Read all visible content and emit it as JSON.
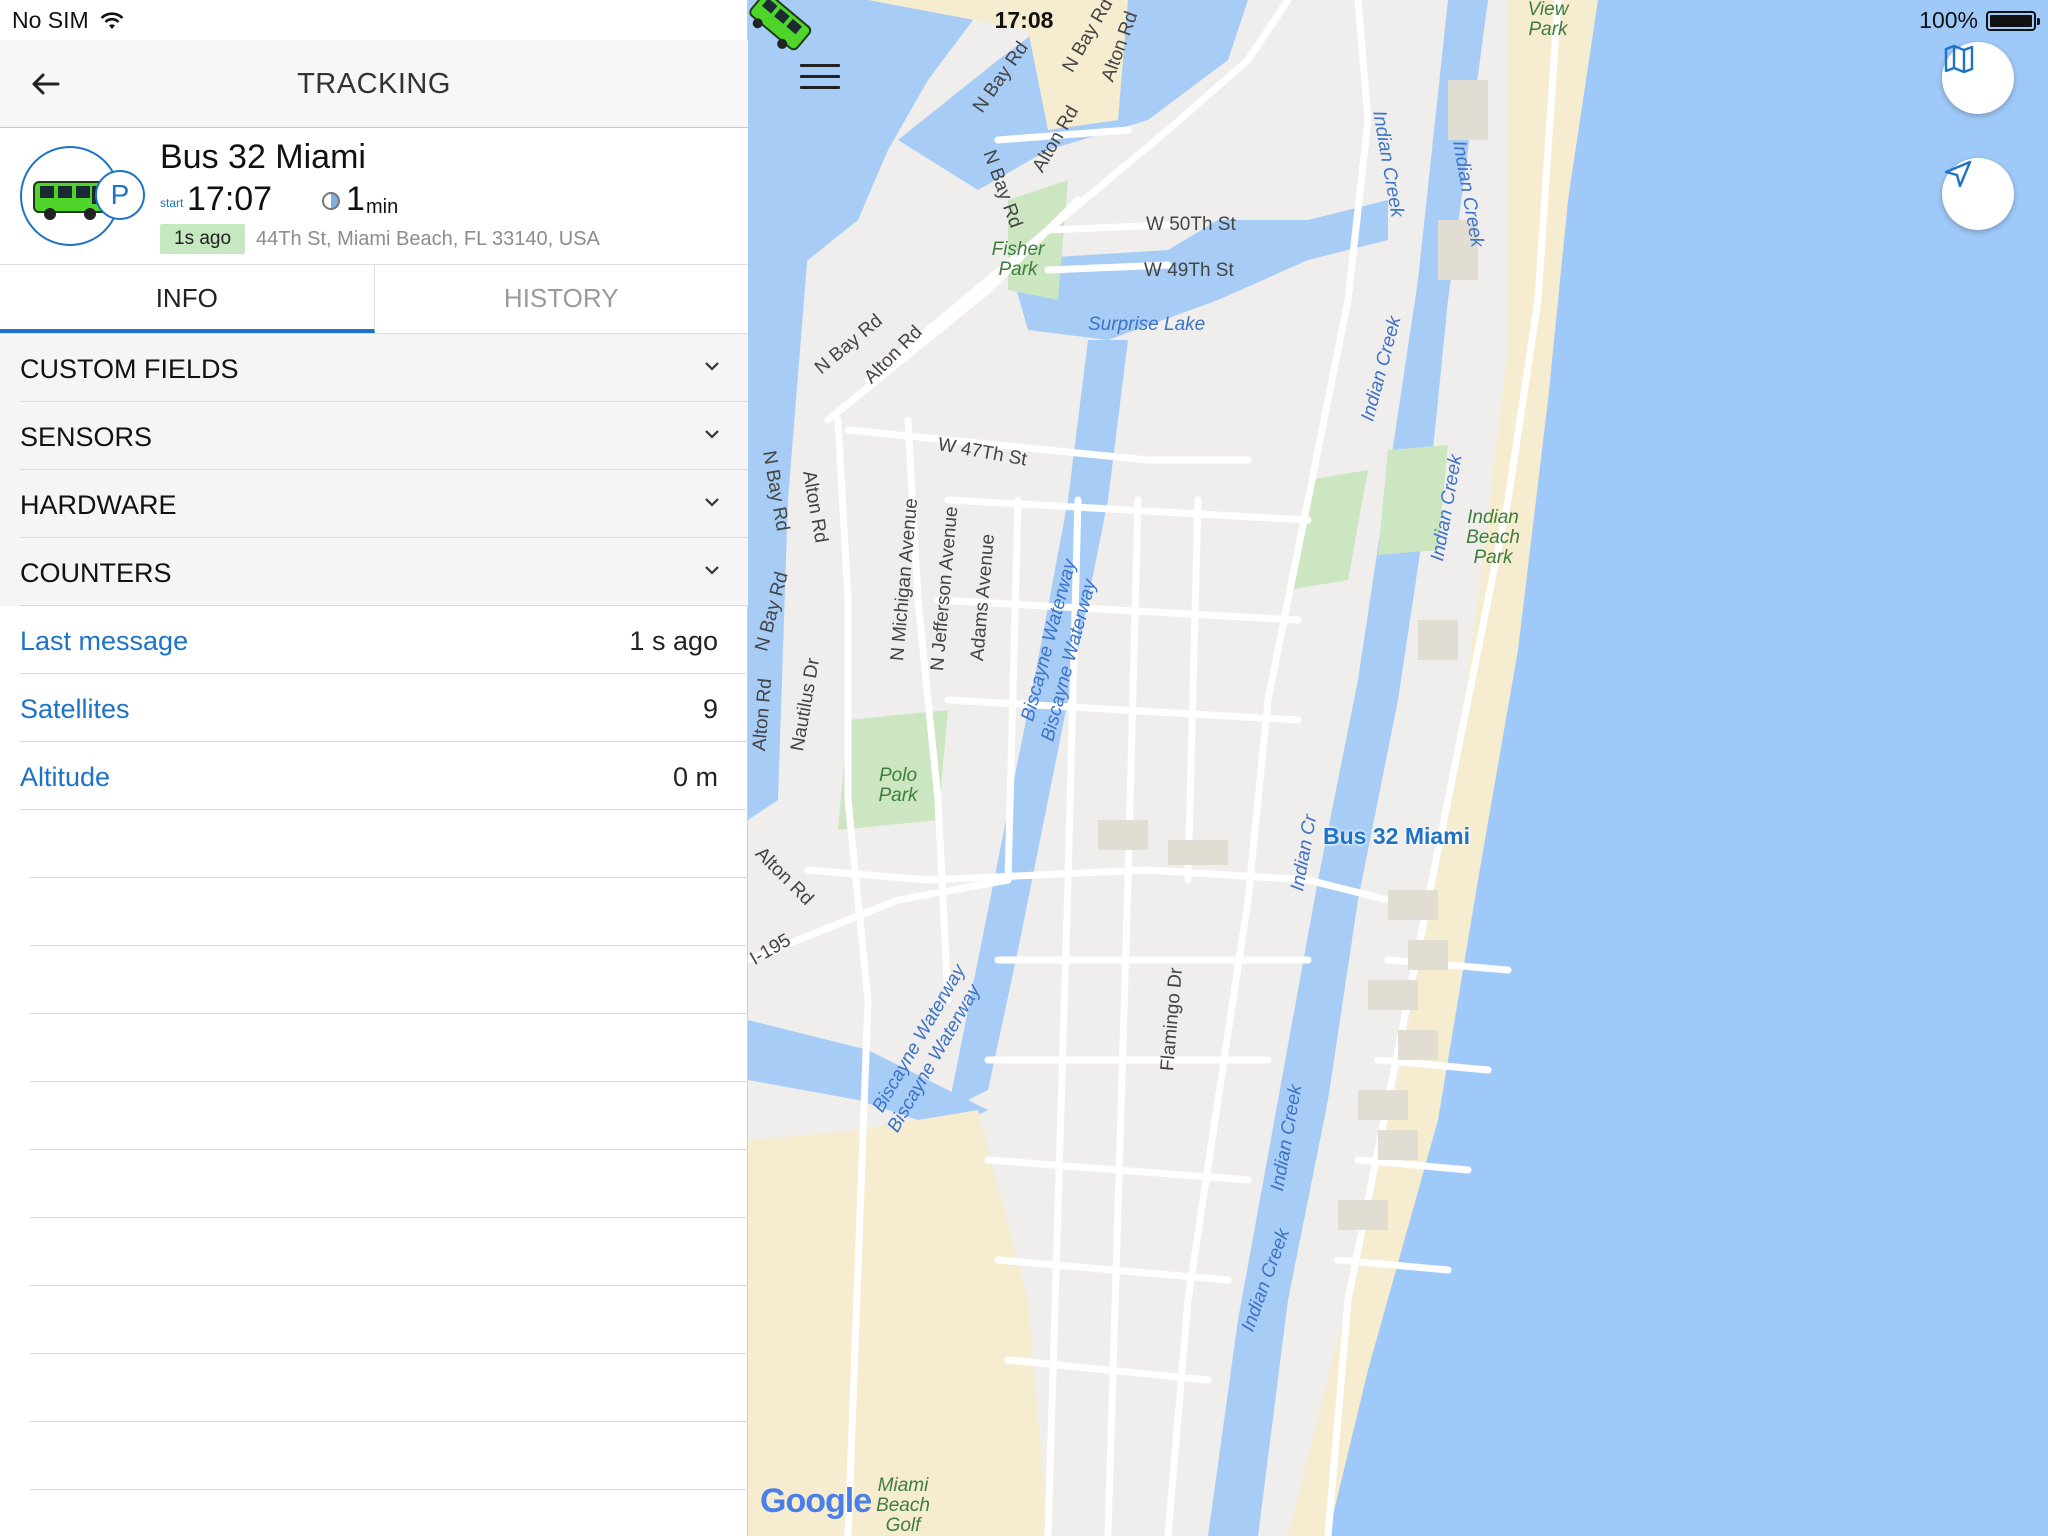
{
  "status_bar": {
    "carrier": "No SIM",
    "time": "17:08",
    "battery": "100%"
  },
  "header": {
    "title": "TRACKING"
  },
  "unit": {
    "name": "Bus 32 Miami",
    "start_label": "start",
    "start_time": "17:07",
    "duration_value": "1",
    "duration_unit": "min",
    "last_update": "1s ago",
    "address": "44Th St, Miami Beach, FL 33140, USA",
    "parking_badge": "P"
  },
  "tabs": [
    {
      "label": "INFO",
      "active": true
    },
    {
      "label": "HISTORY",
      "active": false
    }
  ],
  "sections": [
    {
      "label": "CUSTOM FIELDS"
    },
    {
      "label": "SENSORS"
    },
    {
      "label": "HARDWARE"
    },
    {
      "label": "COUNTERS"
    }
  ],
  "rows": [
    {
      "label": "Last message",
      "value": "1 s ago"
    },
    {
      "label": "Satellites",
      "value": "9"
    },
    {
      "label": "Altitude",
      "value": "0 m"
    }
  ],
  "map": {
    "marker_label": "Bus 32 Miami",
    "attribution": "Google",
    "streets": [
      "N Bay Rd",
      "N Bay Rd",
      "Alton Rd",
      "Alton Rd",
      "N Bay Rd",
      "W 50Th St",
      "W 49Th St",
      "N Bay Rd",
      "Alton Rd",
      "W 47Th St",
      "N Bay Rd",
      "Alton Rd",
      "N Bay Rd",
      "Alton Rd",
      "Nautilus Dr",
      "N Michigan Avenue",
      "N Jefferson Avenue",
      "Adams Avenue",
      "Alton Rd",
      "I-195",
      "Flamingo Dr"
    ],
    "water": [
      "Indian Creek",
      "Indian Creek",
      "Indian Creek",
      "Indian Creek",
      "Surprise Lake",
      "Biscayne Waterway",
      "Biscayne Waterway",
      "Biscayne Waterway",
      "Biscayne Waterway",
      "Indian Cr",
      "Indian Creek",
      "Indian Creek"
    ],
    "parks": [
      "View Park",
      "Fisher Park",
      "Indian Beach Park",
      "Polo Park",
      "Miami Beach Golf"
    ]
  },
  "colors": {
    "accent": "#1d73c7",
    "water": "#a7cdf7",
    "ocean": "#9fc9f8",
    "sand": "#f6ecd0",
    "park": "#cbe6c0",
    "road": "#ffffff",
    "badge_green": "#c5e8c0"
  }
}
